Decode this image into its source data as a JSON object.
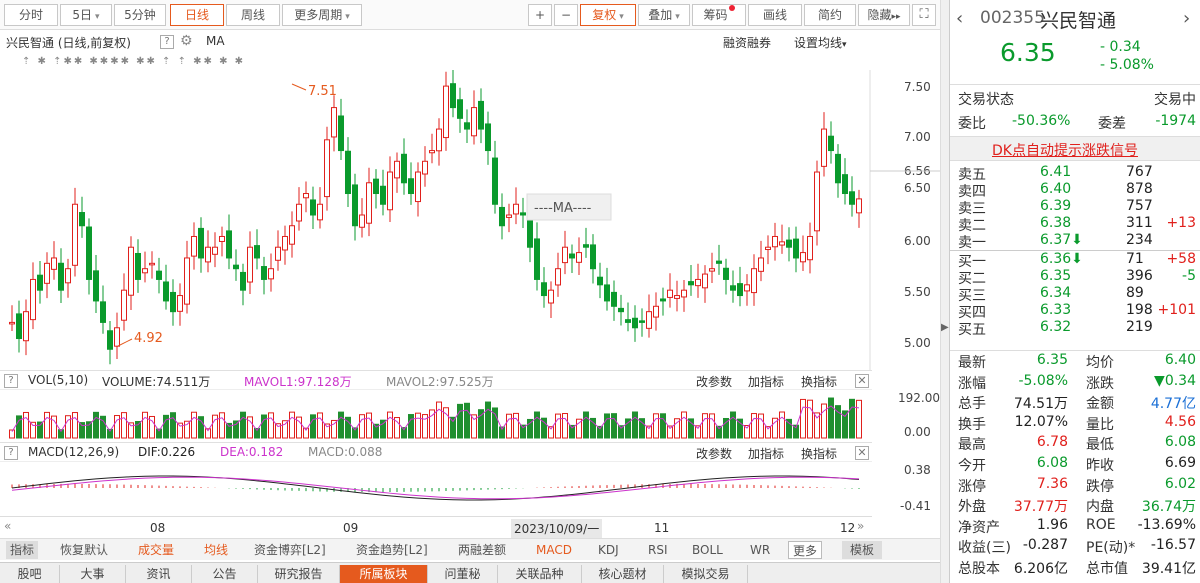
{
  "toolbar": {
    "tabs": [
      "分时",
      "5日",
      "5分钟",
      "日线",
      "周线",
      "更多周期"
    ],
    "right": [
      "+",
      "−",
      "复权",
      "叠加",
      "筹码",
      "画线",
      "简约",
      "隐藏"
    ],
    "arrow": "▾",
    "hide_arrows": "▸▸"
  },
  "info": {
    "title": "兴民智通 (日线,前复权)",
    "ma": "MA",
    "margin": "融资融券",
    "setma": "设置均线"
  },
  "price_axis": [
    "7.50",
    "7.00",
    "6.56",
    "6.50",
    "6.00",
    "5.50",
    "5.00"
  ],
  "annotations": {
    "high": "7.51",
    "low": "4.92",
    "ma_label": "----MA----"
  },
  "markers": "⇡ ✱ ⇡✱✱ ✱✱✱✱ ✱✱ ⇡ ⇡ ✱✱ ✱ ✱",
  "vol": {
    "label": "VOL(5,10)",
    "volume": "VOLUME:74.511万",
    "mavol1": "MAVOL1:97.128万",
    "mavol2": "MAVOL2:97.525万",
    "axis": [
      "192.00",
      "0.00"
    ]
  },
  "macd": {
    "label": "MACD(12,26,9)",
    "dif": "DIF:0.226",
    "dea": "DEA:0.182",
    "macd": "MACD:0.088",
    "axis": [
      "0.38",
      "-0.41"
    ]
  },
  "pane_buttons": [
    "改参数",
    "加指标",
    "换指标"
  ],
  "dates": [
    "08",
    "09",
    "2023/10/09/一",
    "11",
    "12"
  ],
  "indicator_tabs": [
    "指标",
    "恢复默认",
    "成交量",
    "均线",
    "资金博弈[L2]",
    "资金趋势[L2]",
    "两融差额",
    "MACD",
    "KDJ",
    "RSI",
    "BOLL",
    "WR",
    "更多",
    "模板"
  ],
  "bottom_tabs": [
    "股吧",
    "大事",
    "资讯",
    "公告",
    "研究报告",
    "所属板块",
    "问董秘",
    "关联品种",
    "核心题材",
    "模拟交易"
  ],
  "stock": {
    "code": "002355",
    "name": "兴民智通",
    "price": "6.35",
    "change": "- 0.34",
    "pct": "- 5.08%",
    "status_label": "交易状态",
    "status": "交易中",
    "weibi_label": "委比",
    "weibi": "-50.36%",
    "weicha_label": "委差",
    "weicha": "-1974",
    "dk": "DK点自动提示涨跌信号"
  },
  "asks": [
    {
      "l": "卖五",
      "p": "6.41",
      "v": "767",
      "c": ""
    },
    {
      "l": "卖四",
      "p": "6.40",
      "v": "878",
      "c": ""
    },
    {
      "l": "卖三",
      "p": "6.39",
      "v": "757",
      "c": ""
    },
    {
      "l": "卖二",
      "p": "6.38",
      "v": "311",
      "c": "+13"
    },
    {
      "l": "卖一",
      "p": "6.37⬇",
      "v": "234",
      "c": ""
    }
  ],
  "bids": [
    {
      "l": "买一",
      "p": "6.36⬇",
      "v": "71",
      "c": "+58"
    },
    {
      "l": "买二",
      "p": "6.35",
      "v": "396",
      "c": "-5"
    },
    {
      "l": "买三",
      "p": "6.34",
      "v": "89",
      "c": ""
    },
    {
      "l": "买四",
      "p": "6.33",
      "v": "198",
      "c": "+101"
    },
    {
      "l": "买五",
      "p": "6.32",
      "v": "219",
      "c": ""
    }
  ],
  "stats": [
    {
      "a": "最新",
      "av": "6.35",
      "ac": "green",
      "b": "均价",
      "bv": "6.40",
      "bc": "green"
    },
    {
      "a": "涨幅",
      "av": "-5.08%",
      "ac": "green",
      "b": "涨跌",
      "bv": "▼0.34",
      "bc": "green"
    },
    {
      "a": "总手",
      "av": "74.51万",
      "ac": "black",
      "b": "金额",
      "bv": "4.77亿",
      "bc": "blue"
    },
    {
      "a": "换手",
      "av": "12.07%",
      "ac": "black",
      "b": "量比",
      "bv": "4.56",
      "bc": "red"
    },
    {
      "a": "最高",
      "av": "6.78",
      "ac": "red",
      "b": "最低",
      "bv": "6.08",
      "bc": "green"
    },
    {
      "a": "今开",
      "av": "6.08",
      "ac": "green",
      "b": "昨收",
      "bv": "6.69",
      "bc": "black"
    },
    {
      "a": "涨停",
      "av": "7.36",
      "ac": "red",
      "b": "跌停",
      "bv": "6.02",
      "bc": "green"
    },
    {
      "a": "外盘",
      "av": "37.77万",
      "ac": "red",
      "b": "内盘",
      "bv": "36.74万",
      "bc": "green"
    },
    {
      "a": "净资产",
      "av": "1.96",
      "ac": "black",
      "b": "ROE",
      "bv": "-13.69%",
      "bc": "black"
    },
    {
      "a": "收益(三)",
      "av": "-0.287",
      "ac": "black",
      "b": "PE(动)*",
      "bv": "-16.57",
      "bc": "black"
    },
    {
      "a": "总股本",
      "av": "6.206亿",
      "ac": "black",
      "b": "总市值",
      "bv": "39.41亿",
      "bc": "black"
    }
  ],
  "colors": {
    "up": "#e0201c",
    "down": "#0a9a2c",
    "accent": "#e55a1e",
    "mavol1": "#cc33cc",
    "vol_up": "#e0201c",
    "vol_down": "#1f8f2f"
  }
}
